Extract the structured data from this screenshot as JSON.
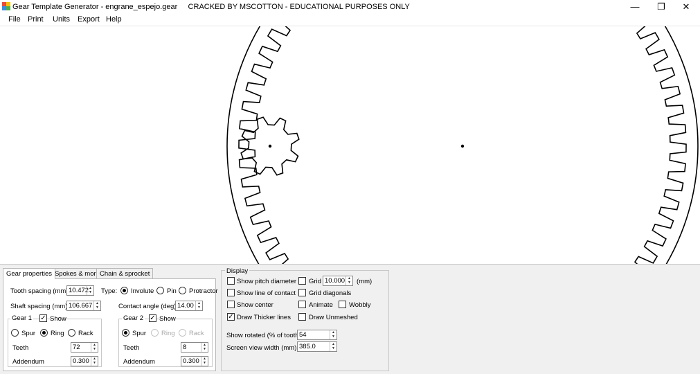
{
  "window": {
    "title": "Gear Template Generator - engrane_espejo.gear     CRACKED BY MSCOTTON - EDUCATIONAL PURPOSES ONLY",
    "minimize_glyph": "—",
    "maximize_glyph": "❐",
    "close_glyph": "✕"
  },
  "menu": [
    "File",
    "Print",
    "Units",
    "Export",
    "Help"
  ],
  "tabs": [
    "Gear properties",
    "Spokes & more",
    "Chain & sprocket"
  ],
  "gear_properties": {
    "tooth_spacing_label": "Tooth spacing (mm)",
    "tooth_spacing_value": "10.472",
    "type_label": "Type:",
    "type_options": [
      "Involute",
      "Pin",
      "Protractor"
    ],
    "type_selected": "Involute",
    "shaft_spacing_label": "Shaft spacing (mm)",
    "shaft_spacing_value": "106.667",
    "contact_angle_label": "Contact angle (deg)",
    "contact_angle_value": "14.00",
    "gear1": {
      "label": "Gear 1",
      "show_label": "Show",
      "show_checked": true,
      "options": [
        "Spur",
        "Ring",
        "Rack"
      ],
      "selected": "Ring",
      "teeth_label": "Teeth",
      "teeth_value": "72",
      "addendum_label": "Addendum",
      "addendum_value": "0.300"
    },
    "gear2": {
      "label": "Gear 2",
      "show_label": "Show",
      "show_checked": true,
      "options": [
        "Spur",
        "Ring",
        "Rack"
      ],
      "selected": "Spur",
      "teeth_label": "Teeth",
      "teeth_value": "8",
      "addendum_label": "Addendum",
      "addendum_value": "0.300"
    }
  },
  "display": {
    "title": "Display",
    "show_pitch_diameter": "Show pitch diameter",
    "show_line_of_contact": "Show line of contact",
    "show_center": "Show center",
    "draw_thicker_lines": "Draw Thicker lines",
    "draw_thicker_checked": true,
    "grid_label": "Grid",
    "grid_value": "10.000",
    "grid_unit": "(mm)",
    "grid_diagonals": "Grid diagonals",
    "animate": "Animate",
    "wobbly": "Wobbly",
    "draw_unmeshed": "Draw Unmeshed",
    "show_rotated_label": "Show rotated (% of tooth)",
    "show_rotated_value": "54",
    "screen_view_width_label": "Screen view width (mm)",
    "screen_view_width_value": "385.0"
  },
  "canvas": {
    "ring_teeth": 72,
    "pinion_teeth": 8
  }
}
